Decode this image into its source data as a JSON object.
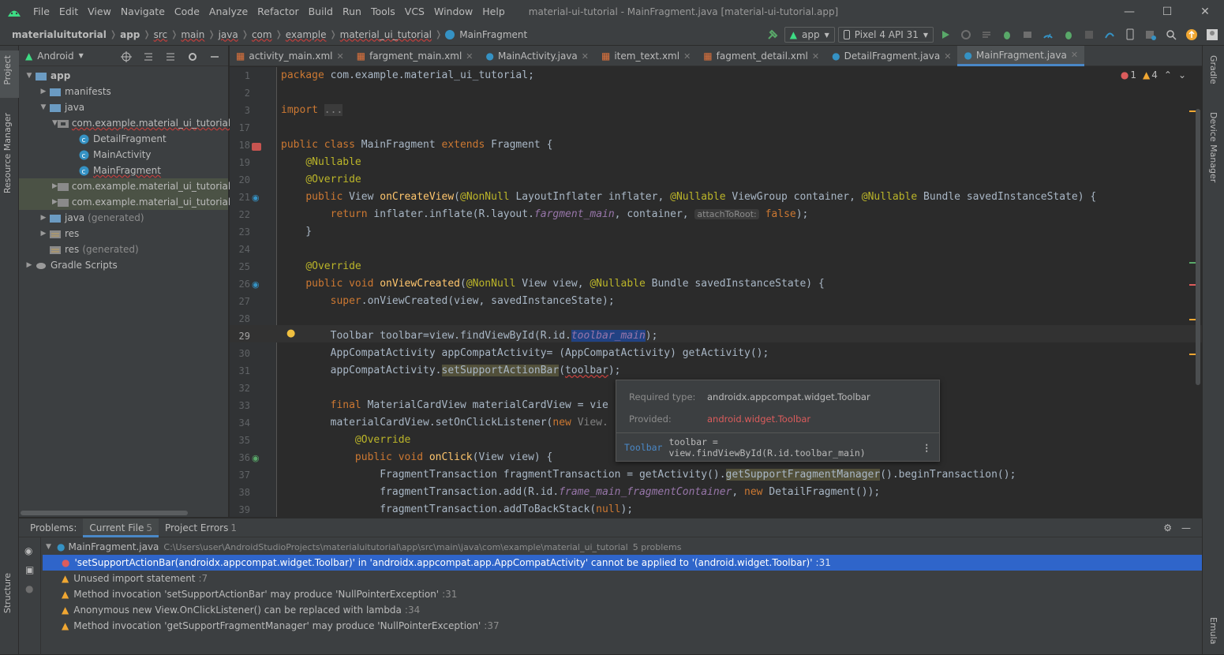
{
  "menubar": {
    "items": [
      "File",
      "Edit",
      "View",
      "Navigate",
      "Code",
      "Analyze",
      "Refactor",
      "Build",
      "Run",
      "Tools",
      "VCS",
      "Window",
      "Help"
    ],
    "title": "material-ui-tutorial - MainFragment.java [material-ui-tutorial.app]"
  },
  "breadcrumbs": [
    "materialuitutorial",
    "app",
    "src",
    "main",
    "java",
    "com",
    "example",
    "material_ui_tutorial",
    "MainFragment"
  ],
  "toolbar": {
    "run_config": "app",
    "device": "Pixel 4 API 31"
  },
  "left_strip": {
    "project": "Project",
    "resource_manager": "Resource Manager",
    "structure": "Structure"
  },
  "right_strip": {
    "gradle": "Gradle",
    "device_manager": "Device Manager",
    "emulator": "Emula"
  },
  "project_panel": {
    "view_selector": "Android",
    "tree": [
      {
        "label": "app",
        "suffix": ""
      },
      {
        "label": "manifests",
        "suffix": ""
      },
      {
        "label": "java",
        "suffix": ""
      },
      {
        "label": "com.example.material_ui_tutorial",
        "suffix": ""
      },
      {
        "label": "DetailFragment",
        "suffix": ""
      },
      {
        "label": "MainActivity",
        "suffix": ""
      },
      {
        "label": "MainFragment",
        "suffix": ""
      },
      {
        "label": "com.example.material_ui_tutorial",
        "suffix": "(a"
      },
      {
        "label": "com.example.material_ui_tutorial",
        "suffix": "(t"
      },
      {
        "label": "java",
        "suffix": "(generated)"
      },
      {
        "label": "res",
        "suffix": ""
      },
      {
        "label": "res",
        "suffix": "(generated)"
      },
      {
        "label": "Gradle Scripts",
        "suffix": ""
      }
    ]
  },
  "editor": {
    "tabs": [
      "activity_main.xml",
      "fargment_main.xml",
      "MainActivity.java",
      "item_text.xml",
      "fagment_detail.xml",
      "DetailFragment.java",
      "MainFragment.java"
    ],
    "active_tab": "MainFragment.java",
    "error_count": "1",
    "warning_count": "4",
    "line_numbers": [
      "1",
      "2",
      "3",
      "17",
      "18",
      "19",
      "20",
      "21",
      "22",
      "23",
      "24",
      "25",
      "26",
      "27",
      "28",
      "29",
      "30",
      "31",
      "32",
      "33",
      "34",
      "35",
      "36",
      "37",
      "38",
      "39"
    ],
    "current_line": "29",
    "param_hint": "attachToRoot:"
  },
  "tooltip": {
    "required_label": "Required type:",
    "required_value": "androidx.appcompat.widget.Toolbar",
    "provided_label": "Provided:",
    "provided_value": "android.widget.Toolbar",
    "footer_type": "Toolbar",
    "footer_code": "toolbar = view.findViewById(R.id.toolbar_main)"
  },
  "problems": {
    "title": "Problems:",
    "tabs": [
      {
        "label": "Current File",
        "count": "5"
      },
      {
        "label": "Project Errors",
        "count": "1"
      }
    ],
    "file": "MainFragment.java",
    "path": "C:\\Users\\user\\AndroidStudioProjects\\materialuitutorial\\app\\src\\main\\java\\com\\example\\material_ui_tutorial",
    "summary": "5 problems",
    "items": [
      {
        "severity": "error",
        "text": "'setSupportActionBar(androidx.appcompat.widget.Toolbar)' in 'androidx.appcompat.app.AppCompatActivity' cannot be applied to '(android.widget.Toolbar)'",
        "line": ":31"
      },
      {
        "severity": "warning",
        "text": "Unused import statement",
        "line": ":7"
      },
      {
        "severity": "warning",
        "text": "Method invocation 'setSupportActionBar' may produce 'NullPointerException'",
        "line": ":31"
      },
      {
        "severity": "warning",
        "text": "Anonymous new View.OnClickListener() can be replaced with lambda",
        "line": ":34"
      },
      {
        "severity": "warning",
        "text": "Method invocation 'getSupportFragmentManager' may produce 'NullPointerException'",
        "line": ":37"
      }
    ]
  },
  "colors": {
    "accent": "#4a88c7",
    "error": "#db5c5c",
    "warning": "#f0a732",
    "selection": "#2f65ca"
  }
}
